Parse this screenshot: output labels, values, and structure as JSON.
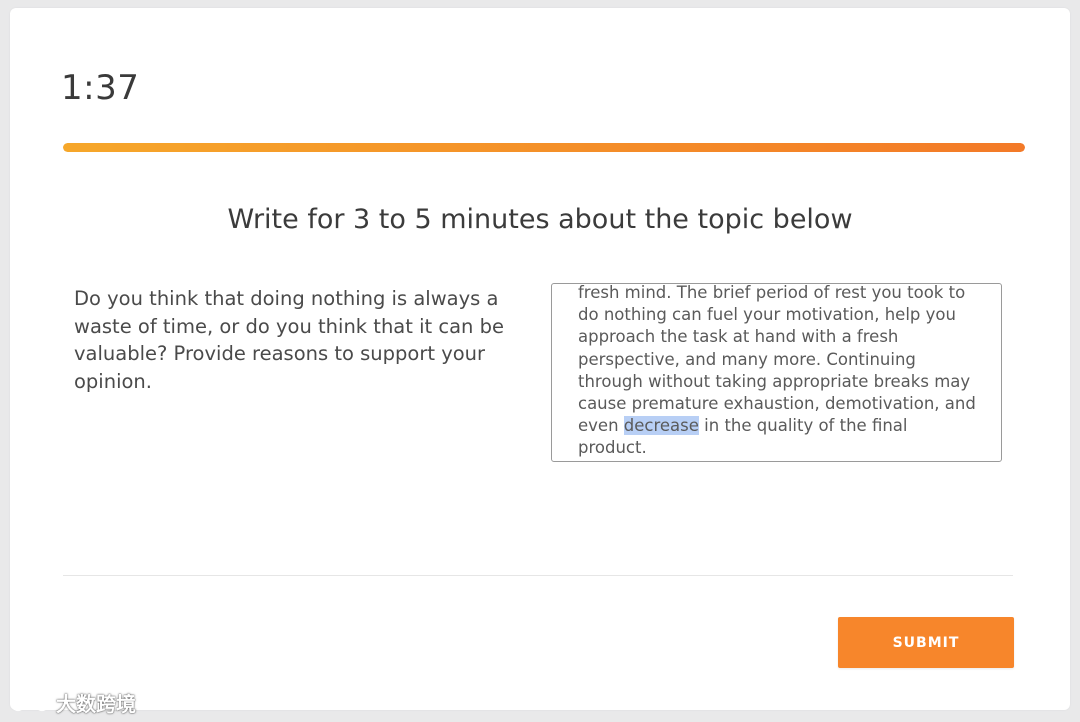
{
  "timer": {
    "value": "1:37"
  },
  "progress": {
    "fraction": 1.0,
    "color_start": "#f6a72a",
    "color_end": "#f37a28"
  },
  "instruction": "Write for 3 to 5 minutes about the topic below",
  "question": "Do you think that doing nothing is always a waste of time, or do you think that it can be valuable? Provide reasons to support your opinion.",
  "answer": {
    "before": "fresh mind. The brief period of rest you took to do nothing can fuel your motivation, help you approach the task at hand with a fresh perspective, and many more. Continuing through without taking appropriate breaks may cause premature exhaustion, demotivation, and even ",
    "selected": "decrease",
    "after": " in the quality of the final product."
  },
  "submit_label": "SUBMIT",
  "watermark": {
    "text": "大数跨境"
  },
  "colors": {
    "accent": "#f7862b",
    "selection": "#b8cff5"
  }
}
